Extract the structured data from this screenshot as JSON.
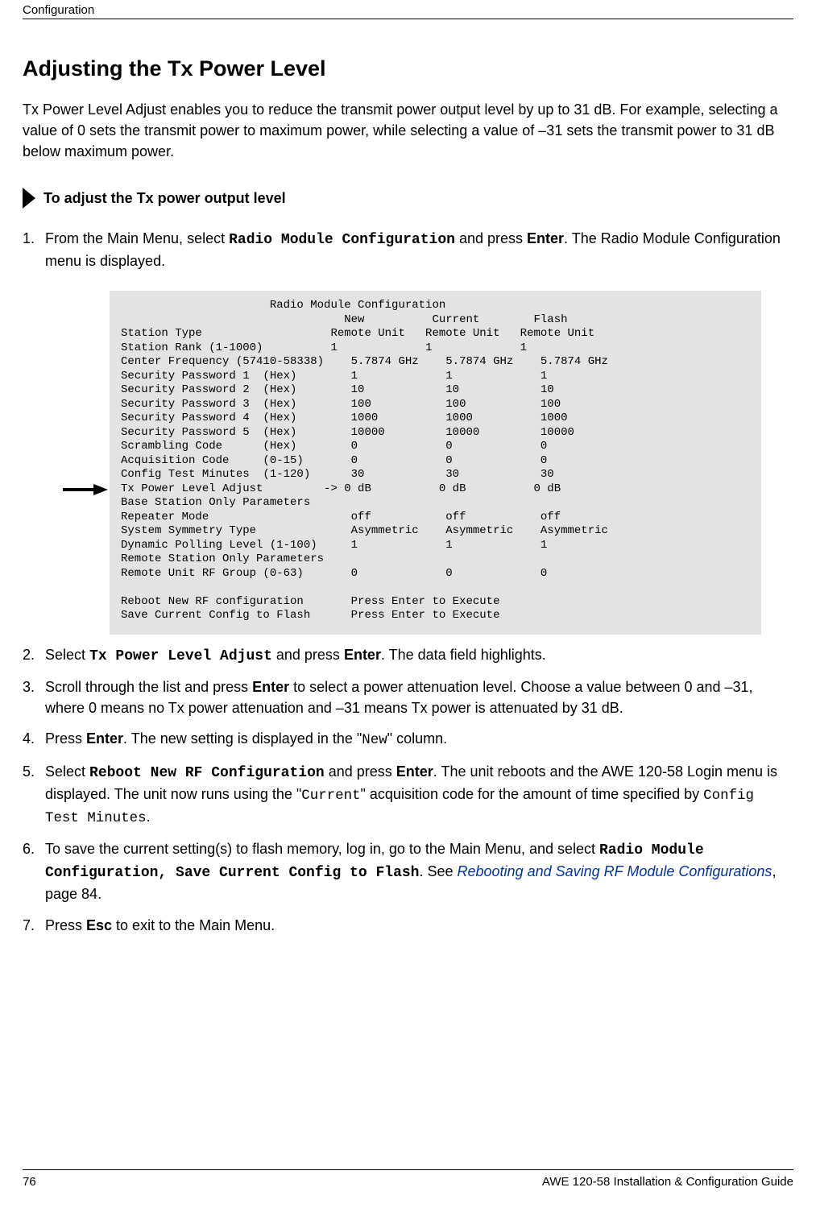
{
  "header": {
    "section": "Configuration"
  },
  "title": "Adjusting the Tx Power Level",
  "intro": "Tx Power Level Adjust enables you to reduce the transmit power output level by up to 31 dB. For example, selecting a value of 0 sets the transmit power to maximum power, while selecting a value of –31 sets the transmit power to 31 dB below maximum power.",
  "subhead": "To adjust the Tx power output level",
  "steps": {
    "s1": {
      "a": "From the Main Menu, select ",
      "b": "Radio Module Configuration",
      "c": " and press ",
      "d": "Enter",
      "e": ". The Radio Module Configuration menu is displayed."
    },
    "s2": {
      "a": "Select ",
      "b": "Tx Power Level Adjust",
      "c": " and press ",
      "d": "Enter",
      "e": ". The data field highlights."
    },
    "s3": {
      "a": "Scroll through the list and press ",
      "b": "Enter",
      "c": " to select a power attenuation level. Choose a value between 0 and –31, where 0 means no Tx power attenuation and –31 means Tx power is attenuated by 31 dB."
    },
    "s4": {
      "a": "Press ",
      "b": "Enter",
      "c": ". The new setting is displayed in the \"",
      "d": "New",
      "e": "\" column."
    },
    "s5": {
      "a": "Select ",
      "b": "Reboot New RF Configuration",
      "c": " and press ",
      "d": "Enter",
      "e": ". The unit reboots and the AWE 120-58 Login menu is displayed. The unit now runs using the \"",
      "f": "Current",
      "g": "\" acquisition code for the amount of time specified by ",
      "h": "Config Test Minutes",
      "i": "."
    },
    "s6": {
      "a": "To save the current setting(s) to flash memory, log in, go to the Main Menu, and select ",
      "b": "Radio Module Configuration, Save Current Config to Flash",
      "c": ". See ",
      "d": "Rebooting and Saving RF Module Configurations",
      "e": ", page 84."
    },
    "s7": {
      "a": "Press ",
      "b": "Esc",
      "c": " to exit to the Main Menu."
    }
  },
  "panel": {
    "arrow_row_index": 13,
    "lines": [
      "                      Radio Module Configuration",
      "                                 New          Current        Flash",
      "Station Type                   Remote Unit   Remote Unit   Remote Unit",
      "Station Rank (1-1000)          1             1             1",
      "Center Frequency (57410-58338)    5.7874 GHz    5.7874 GHz    5.7874 GHz",
      "Security Password 1  (Hex)        1             1             1",
      "Security Password 2  (Hex)        10            10            10",
      "Security Password 3  (Hex)        100           100           100",
      "Security Password 4  (Hex)        1000          1000          1000",
      "Security Password 5  (Hex)        10000         10000         10000",
      "Scrambling Code      (Hex)        0             0             0",
      "Acquisition Code     (0-15)       0             0             0",
      "Config Test Minutes  (1-120)      30            30            30",
      "Tx Power Level Adjust         -> 0 dB          0 dB          0 dB",
      "Base Station Only Parameters",
      "Repeater Mode                     off           off           off",
      "System Symmetry Type              Asymmetric    Asymmetric    Asymmetric",
      "Dynamic Polling Level (1-100)     1             1             1",
      "Remote Station Only Parameters",
      "Remote Unit RF Group (0-63)       0             0             0",
      "",
      "Reboot New RF configuration       Press Enter to Execute",
      "Save Current Config to Flash      Press Enter to Execute"
    ]
  },
  "footer": {
    "page": "76",
    "doc_title": "AWE 120-58 Installation & Configuration Guide"
  }
}
